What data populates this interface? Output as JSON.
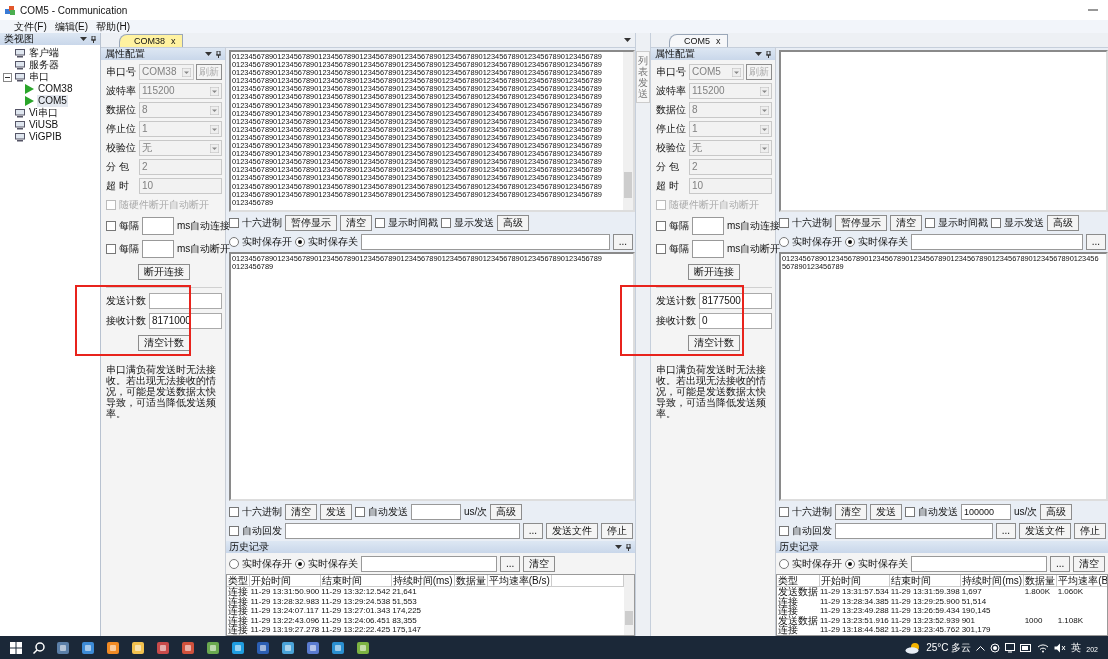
{
  "window": {
    "title": "COM5 - Communication"
  },
  "menu": [
    "文件(F)",
    "编辑(E)",
    "帮助(H)"
  ],
  "sidebar": {
    "title": "类视图",
    "items": [
      {
        "label": "客户端",
        "kind": "device"
      },
      {
        "label": "服务器",
        "kind": "device"
      },
      {
        "label": "串口",
        "kind": "device",
        "expanded": true,
        "children": [
          {
            "label": "COM38",
            "kind": "port",
            "selected": false
          },
          {
            "label": "COM5",
            "kind": "port",
            "selected": true
          }
        ]
      },
      {
        "label": "Vi串口",
        "kind": "device"
      },
      {
        "label": "ViUSB",
        "kind": "device"
      },
      {
        "label": "ViGPIB",
        "kind": "device"
      }
    ]
  },
  "side_tab": "列表发送",
  "panes": [
    {
      "tab": {
        "label": "COM38",
        "close": "x",
        "selected": true
      },
      "properties": {
        "title": "属性配置",
        "fields": [
          {
            "label": "串口号",
            "value": "COM38",
            "kind": "select",
            "disabled": true,
            "button": "刷新"
          },
          {
            "label": "波特率",
            "value": "115200",
            "kind": "select",
            "disabled": true
          },
          {
            "label": "数据位",
            "value": "8",
            "kind": "select",
            "disabled": true
          },
          {
            "label": "停止位",
            "value": "1",
            "kind": "select",
            "disabled": true
          },
          {
            "label": "校验位",
            "value": "无",
            "kind": "select",
            "disabled": true
          },
          {
            "label": "分 包",
            "value": "2",
            "kind": "text",
            "disabled": true
          },
          {
            "label": "超 时",
            "value": "10",
            "kind": "text",
            "disabled": true
          }
        ],
        "hw_disconnect": {
          "label": "随硬件断开自动断开",
          "checked": false,
          "disabled": true
        },
        "timers": [
          {
            "prefix": "每隔",
            "suffix": "ms自动连接",
            "checked": false
          },
          {
            "prefix": "每隔",
            "suffix": "ms自动断开",
            "checked": false
          }
        ],
        "disconnect_button": "断开连接",
        "counters": [
          {
            "label": "发送计数"
          },
          {
            "label": "接收计数",
            "value": "8171000"
          }
        ],
        "clear_counts_button": "清空计数",
        "note": "串口满负荷发送时无法接收。若出现无法接收的情况，可能是发送数据太快导致，可适当降低发送频率。"
      },
      "receive_lines": [
        "012345678901234567890123456789012345678901234567890123456789012345678901234567890123456789",
        "012345678901234567890123456789012345678901234567890123456789012345678901234567890123456789",
        "012345678901234567890123456789012345678901234567890123456789012345678901234567890123456789",
        "012345678901234567890123456789012345678901234567890123456789012345678901234567890123456789",
        "012345678901234567890123456789012345678901234567890123456789012345678901234567890123456789",
        "012345678901234567890123456789012345678901234567890123456789012345678901234567890123456789",
        "012345678901234567890123456789012345678901234567890123456789012345678901234567890123456789",
        "012345678901234567890123456789012345678901234567890123456789012345678901234567890123456789",
        "012345678901234567890123456789012345678901234567890123456789012345678901234567890123456789",
        "012345678901234567890123456789012345678901234567890123456789012345678901234567890123456789",
        "012345678901234567890123456789012345678901234567890123456789012345678901234567890123456789",
        "012345678901234567890123456789012345678901234567890123456789012345678901234567890123456789",
        "012345678901234567890123456789012345678901234567890123456789012345678901234567890123456789",
        "012345678901234567890123456789012345678901234567890123456789012345678901234567890123456789",
        "012345678901234567890123456789012345678901234567890123456789012345678901234567890123456789",
        "012345678901234567890123456789012345678901234567890123456789012345678901234567890123456789",
        "012345678901234567890123456789012345678901234567890123456789012345678901234567890123456789",
        "012345678901234567890123456789012345678901234567890123456789012345678901234567890123456789",
        "0123456789"
      ],
      "receive_controls": [
        [
          {
            "kind": "checkbox",
            "label": "十六进制",
            "checked": false
          },
          {
            "kind": "button",
            "label": "暂停显示"
          },
          {
            "kind": "button",
            "label": "清空"
          },
          {
            "kind": "checkbox",
            "label": "显示时间戳",
            "checked": false
          },
          {
            "kind": "checkbox",
            "label": "显示发送",
            "checked": false
          },
          {
            "kind": "button",
            "label": "高级"
          }
        ],
        [
          {
            "kind": "radio",
            "label": "实时保存开",
            "selected": false
          },
          {
            "kind": "radio",
            "label": "实时保存关",
            "selected": true
          },
          {
            "kind": "field"
          },
          {
            "kind": "button",
            "label": "..."
          }
        ]
      ],
      "send_lines": [
        "012345678901234567890123456789012345678901234567890123456789012345678901234567890123456789",
        "0123456789"
      ],
      "send_controls": [
        [
          {
            "kind": "checkbox",
            "label": "十六进制",
            "checked": false
          },
          {
            "kind": "button",
            "label": "清空"
          },
          {
            "kind": "button",
            "label": "发送"
          },
          {
            "kind": "checkbox",
            "label": "自动发送",
            "checked": false
          },
          {
            "kind": "field"
          },
          {
            "kind": "unit",
            "label": "us/次"
          },
          {
            "kind": "button",
            "label": "高级"
          }
        ],
        [
          {
            "kind": "checkbox",
            "label": "自动回发",
            "checked": false
          },
          {
            "kind": "field"
          },
          {
            "kind": "button",
            "label": "..."
          },
          {
            "kind": "button",
            "label": "发送文件"
          },
          {
            "kind": "button",
            "label": "停止"
          }
        ]
      ],
      "history": {
        "title": "历史记录",
        "controls": [
          [
            {
              "kind": "radio",
              "label": "实时保存开",
              "selected": false
            },
            {
              "kind": "radio",
              "label": "实时保存关",
              "selected": true
            },
            {
              "kind": "field"
            },
            {
              "kind": "button",
              "label": "..."
            },
            {
              "kind": "button",
              "label": "清空"
            }
          ]
        ],
        "columns": [
          "类型",
          "开始时间",
          "结束时间",
          "持续时间(ms)",
          "数据量",
          "平均速率(B/s)"
        ],
        "rows": [
          {
            "type": "连接",
            "start": "11-29 13:31:50.900",
            "end": "11-29 13:32:12.542",
            "duration": "21,641"
          },
          {
            "type": "连接",
            "start": "11-29 13:28:32.983",
            "end": "11-29 13:29:24.538",
            "duration": "51,553"
          },
          {
            "type": "连接",
            "start": "11-29 13:24:07.117",
            "end": "11-29 13:27:01.343",
            "duration": "174,225"
          },
          {
            "type": "连接",
            "start": "11-29 13:22:43.096",
            "end": "11-29 13:24:06.451",
            "duration": "83,355"
          },
          {
            "type": "连接",
            "start": "11-29 13:19:27.278",
            "end": "11-29 13:22:22.425",
            "duration": "175,147"
          }
        ]
      }
    },
    {
      "tab": {
        "label": "COM5",
        "close": "x",
        "selected": false
      },
      "properties": {
        "title": "属性配置",
        "fields": [
          {
            "label": "串口号",
            "value": "COM5",
            "kind": "select",
            "disabled": true,
            "button": "刷新"
          },
          {
            "label": "波特率",
            "value": "115200",
            "kind": "select",
            "disabled": true
          },
          {
            "label": "数据位",
            "value": "8",
            "kind": "select",
            "disabled": true
          },
          {
            "label": "停止位",
            "value": "1",
            "kind": "select",
            "disabled": true
          },
          {
            "label": "校验位",
            "value": "无",
            "kind": "select",
            "disabled": true
          },
          {
            "label": "分 包",
            "value": "2",
            "kind": "text",
            "disabled": true
          },
          {
            "label": "超 时",
            "value": "10",
            "kind": "text",
            "disabled": true
          }
        ],
        "hw_disconnect": {
          "label": "随硬件断开自动断开",
          "checked": false,
          "disabled": true
        },
        "timers": [
          {
            "prefix": "每隔",
            "suffix": "ms自动连接",
            "checked": false
          },
          {
            "prefix": "每隔",
            "suffix": "ms自动断开",
            "checked": false
          }
        ],
        "disconnect_button": "断开连接",
        "counters": [
          {
            "label": "发送计数",
            "value": "8177500"
          },
          {
            "label": "接收计数",
            "value": "0"
          }
        ],
        "clear_counts_button": "清空计数",
        "note": "串口满负荷发送时无法接收。若出现无法接收的情况，可能是发送数据太快导致，可适当降低发送频率。"
      },
      "receive_controls": [
        [
          {
            "kind": "checkbox",
            "label": "十六进制",
            "checked": false
          },
          {
            "kind": "button",
            "label": "暂停显示"
          },
          {
            "kind": "button",
            "label": "清空"
          },
          {
            "kind": "checkbox",
            "label": "显示时间戳",
            "checked": false
          },
          {
            "kind": "checkbox",
            "label": "显示发送",
            "checked": false
          },
          {
            "kind": "button",
            "label": "高级"
          }
        ],
        [
          {
            "kind": "radio",
            "label": "实时保存开",
            "selected": false
          },
          {
            "kind": "radio",
            "label": "实时保存关",
            "selected": true
          },
          {
            "kind": "field"
          },
          {
            "kind": "button",
            "label": "..."
          }
        ]
      ],
      "send_lines": [
        "01234567890123456789012345678901234567890123456789012345678901234567890123456",
        "567890123456789"
      ],
      "send_controls": [
        [
          {
            "kind": "checkbox",
            "label": "十六进制",
            "checked": false
          },
          {
            "kind": "button",
            "label": "清空"
          },
          {
            "kind": "button",
            "label": "发送"
          },
          {
            "kind": "checkbox",
            "label": "自动发送",
            "checked": false
          },
          {
            "kind": "field",
            "value": "100000"
          },
          {
            "kind": "unit",
            "label": "us/次"
          },
          {
            "kind": "button",
            "label": "高级"
          }
        ],
        [
          {
            "kind": "checkbox",
            "label": "自动回发",
            "checked": false
          },
          {
            "kind": "field"
          },
          {
            "kind": "button",
            "label": "..."
          },
          {
            "kind": "button",
            "label": "发送文件"
          },
          {
            "kind": "button",
            "label": "停止"
          }
        ]
      ],
      "history": {
        "title": "历史记录",
        "controls": [
          [
            {
              "kind": "radio",
              "label": "实时保存开",
              "selected": false
            },
            {
              "kind": "radio",
              "label": "实时保存关",
              "selected": true
            },
            {
              "kind": "field"
            },
            {
              "kind": "button",
              "label": "..."
            },
            {
              "kind": "button",
              "label": "清空"
            }
          ]
        ],
        "columns": [
          "类型",
          "开始时间",
          "结束时间",
          "持续时间(ms)",
          "数据量",
          "平均速率(B"
        ],
        "rows": [
          {
            "type": "发送数据",
            "start": "11-29 13:31:57.534",
            "end": "11-29 13:31:59.398",
            "duration": "1,697",
            "amount": "1.800K",
            "rate": "1.060K"
          },
          {
            "type": "连接",
            "start": "11-29 13:28:34.385",
            "end": "11-29 13:29:25.900",
            "duration": "51,514"
          },
          {
            "type": "连接",
            "start": "11-29 13:23:49.288",
            "end": "11-29 13:26:59.434",
            "duration": "190,145"
          },
          {
            "type": "发送数据",
            "start": "11-29 13:23:51.916",
            "end": "11-29 13:23:52.939",
            "duration": "901",
            "amount": "1000",
            "rate": "1.108K"
          },
          {
            "type": "连接",
            "start": "11-29 13:18:44.582",
            "end": "11-29 13:23:45.762",
            "duration": "301,179"
          }
        ]
      }
    }
  ],
  "taskbar": {
    "weather": "25°C 多云",
    "ime": "英",
    "clock": "202"
  }
}
